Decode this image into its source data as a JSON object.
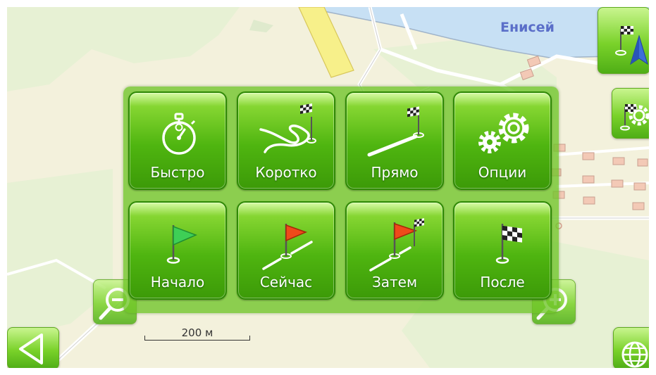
{
  "map": {
    "river_label": "Енисей",
    "scale_label": "200 м",
    "colors": {
      "land": "#f3f1dc",
      "water": "#c7e0f4",
      "green": "#e7f1d4",
      "road": "#ffffff",
      "highway": "#f7f08a",
      "building": "#f3c9b6"
    }
  },
  "menu": {
    "items": [
      {
        "label": "Быстро",
        "icon": "stopwatch-icon"
      },
      {
        "label": "Коротко",
        "icon": "winding-route-flag-icon"
      },
      {
        "label": "Прямо",
        "icon": "straight-route-flag-icon"
      },
      {
        "label": "Опции",
        "icon": "gears-icon"
      },
      {
        "label": "Начало",
        "icon": "green-flag-icon"
      },
      {
        "label": "Сейчас",
        "icon": "red-flag-route-icon"
      },
      {
        "label": "Затем",
        "icon": "red-checkered-flags-icon"
      },
      {
        "label": "После",
        "icon": "checkered-flag-icon"
      }
    ]
  },
  "side_buttons": {
    "navigate": "flag-compass-icon",
    "route_settings": "flag-gear-icon",
    "zoom_out": "zoom-out-icon",
    "zoom_in": "zoom-in-icon",
    "back": "back-arrow-icon",
    "globe": "globe-icon"
  },
  "colors": {
    "accent": "#4fb510",
    "panel": "#6ec428"
  }
}
